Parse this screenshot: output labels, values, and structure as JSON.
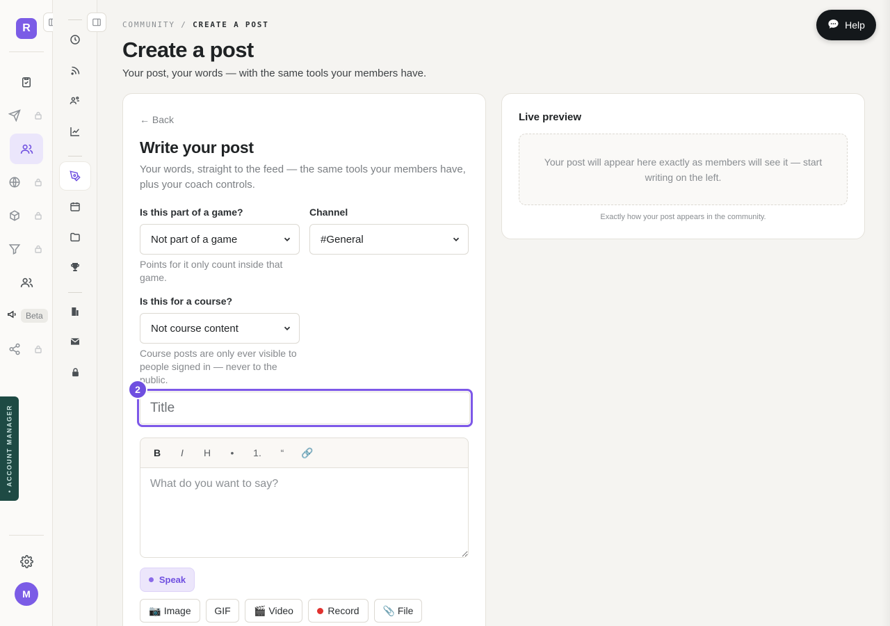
{
  "brand": {
    "letter": "R"
  },
  "rail1": {
    "beta_label": "Beta",
    "account_manager_label": "• ACCOUNT MANAGER",
    "avatar_initial": "M"
  },
  "breadcrumb": {
    "parent": "COMMUNITY",
    "separator": "/",
    "current": "CREATE A POST"
  },
  "page": {
    "title": "Create a post",
    "subtitle": "Your post, your words — with the same tools your members have."
  },
  "help": {
    "label": "Help"
  },
  "editor": {
    "back_label": "← Back",
    "title": "Write your post",
    "subtitle": "Your words, straight to the feed — the same tools your members have, plus your coach controls.",
    "game": {
      "label": "Is this part of a game?",
      "selected": "Not part of a game",
      "hint": "Points for it only count inside that game."
    },
    "channel": {
      "label": "Channel",
      "selected": "#General"
    },
    "course": {
      "label": "Is this for a course?",
      "selected": "Not course content",
      "hint": "Course posts are only ever visible to people signed in — never to the public."
    },
    "step_number": "2",
    "title_placeholder": "Title",
    "toolbar": {
      "bold": "B",
      "italic": "I",
      "heading": "H",
      "bullet": "•",
      "numbered": "1.",
      "quote": "“",
      "link": "🔗"
    },
    "body_placeholder": "What do you want to say?",
    "speak_label": "Speak",
    "media": {
      "image": "📷 Image",
      "gif": "GIF",
      "video": "🎬 Video",
      "record": "Record",
      "file": "📎 File"
    }
  },
  "preview": {
    "title": "Live preview",
    "empty_text": "Your post will appear here exactly as members will see it — start writing on the left.",
    "footer": "Exactly how your post appears in the community."
  },
  "colors": {
    "accent": "#6f4fe0",
    "account_manager_bg": "#1e4a44",
    "help_bg": "#14181b",
    "record": "#e0322f"
  }
}
